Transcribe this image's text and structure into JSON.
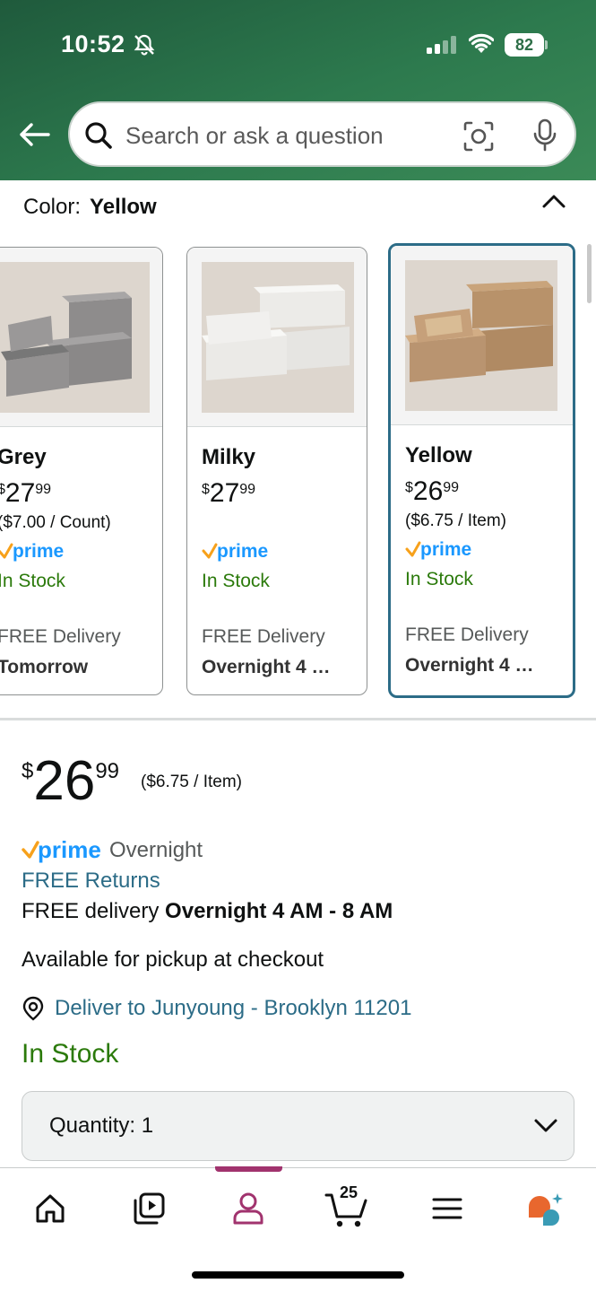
{
  "status_bar": {
    "time": "10:52",
    "battery": "82"
  },
  "search": {
    "placeholder": "Search or ask a question"
  },
  "color_selector": {
    "label": "Color:",
    "selected": "Yellow"
  },
  "swatches": [
    {
      "name": "Grey",
      "price_dollars": "27",
      "price_cents": "99",
      "currency": "$",
      "unit_price": "($7.00 / Count)",
      "prime": "prime",
      "stock": "In Stock",
      "delivery": "FREE Delivery",
      "delivery_day": "Tomorrow",
      "selected": false
    },
    {
      "name": "Milky",
      "price_dollars": "27",
      "price_cents": "99",
      "currency": "$",
      "unit_price": "",
      "prime": "prime",
      "stock": "In Stock",
      "delivery": "FREE Delivery",
      "delivery_day": "Overnight 4 …",
      "selected": false
    },
    {
      "name": "Yellow",
      "price_dollars": "26",
      "price_cents": "99",
      "currency": "$",
      "unit_price": "($6.75 / Item)",
      "prime": "prime",
      "stock": "In Stock",
      "delivery": "FREE Delivery",
      "delivery_day": "Overnight 4 …",
      "selected": true
    }
  ],
  "buy_box": {
    "currency": "$",
    "price_whole": "26",
    "price_fraction": "99",
    "unit_price": "($6.75 / Item)",
    "prime_label": "prime",
    "prime_suffix": "Overnight",
    "free_returns": "FREE Returns",
    "free_delivery_prefix": "FREE delivery",
    "free_delivery_time": "Overnight 4 AM - 8 AM",
    "pickup": "Available for pickup at checkout",
    "deliver_to": "Deliver to Junyoung - Brooklyn 11201",
    "stock": "In Stock",
    "quantity_label": "Quantity:",
    "quantity_value": "1"
  },
  "bottom_nav": {
    "items": [
      "home-icon",
      "video-icon",
      "account-icon",
      "cart-icon",
      "menu-icon",
      "rufus-icon"
    ],
    "cart_count": "25",
    "active": "account-icon"
  },
  "colors": {
    "header_green": "#2d7a4e",
    "link": "#2c6c87",
    "stock_green": "#2b7a0b",
    "prime_blue": "#1a98ff",
    "prime_check": "#f7a11b",
    "active_nav": "#a1336e",
    "selected_border": "#2c6c87"
  }
}
